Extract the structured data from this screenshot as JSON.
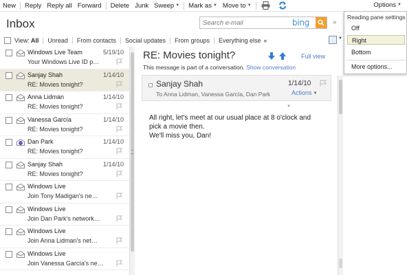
{
  "toolbar": {
    "items": [
      "New",
      "Reply",
      "Reply all",
      "Forward",
      "Delete",
      "Junk",
      "Sweep",
      "Mark as",
      "Move to"
    ],
    "options": "Options"
  },
  "inbox": {
    "title": "Inbox",
    "search_placeholder": "Search e-mail",
    "search_brand": "bing"
  },
  "filters": {
    "view_label": "View:",
    "items": [
      "All",
      "Unread",
      "From contacts",
      "Social updates",
      "From groups",
      "Everything else"
    ],
    "more": "«"
  },
  "messages": [
    {
      "sender": "Windows Live Team",
      "date": "5/19/10",
      "subject": "Your Windows Live ID p…"
    },
    {
      "sender": "Sanjay Shah",
      "date": "1/14/10",
      "subject": "RE: Movies tonight?"
    },
    {
      "sender": "Anna Lidman",
      "date": "1/14/10",
      "subject": "RE: Movies tonight?"
    },
    {
      "sender": "Vanessa García",
      "date": "1/14/10",
      "subject": "RE: Movies tonight?"
    },
    {
      "sender": "Dan Park",
      "date": "1/14/10",
      "subject": "RE: Movies tonight?"
    },
    {
      "sender": "Sanjay Shah",
      "date": "1/14/10",
      "subject": "RE: Movies tonight?"
    },
    {
      "sender": "Windows Live",
      "date": "",
      "subject": "Join Tony Madigan's ne…"
    },
    {
      "sender": "Windows Live",
      "date": "",
      "subject": "Join Dan Park's network…"
    },
    {
      "sender": "Windows Live",
      "date": "",
      "subject": "Join Anna Lidman's net…"
    },
    {
      "sender": "Windows Live",
      "date": "",
      "subject": "Join Vanessa García's ne…"
    }
  ],
  "reading": {
    "subject": "RE: Movies tonight?",
    "full_view": "Full view",
    "conversation_note": "This message is part of a conversation.",
    "show_conversation": "Show conversation",
    "sender": "Sanjay Shah",
    "to": "To Anna Lidman, Vanessa García, Dan Park",
    "date": "1/14/10",
    "actions": "Actions",
    "body_lines": [
      "All right, let's meet at our usual place at 8 o'clock and",
      "pick a movie then.",
      "We'll miss you, Dan!"
    ]
  },
  "reading_pane_settings": {
    "header": "Reading pane settings",
    "options": [
      "Off",
      "Right",
      "Bottom"
    ],
    "selected": "Right",
    "more": "More options..."
  },
  "colors": {
    "accent": "#4a7ec7",
    "selected_row": "#ede9dc",
    "search_button": "#f29f2b",
    "bing_blue": "#4a90d9"
  },
  "icons": {
    "print": "printer-icon",
    "sync": "sync-icon",
    "search": "search-icon",
    "envelope": "envelope-icon",
    "flag": "flag-icon"
  }
}
